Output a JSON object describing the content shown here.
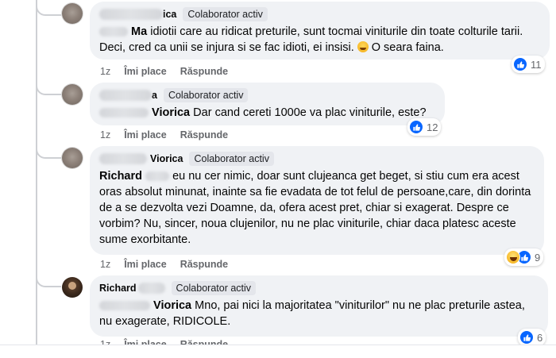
{
  "comments": [
    {
      "name_visible": "ica",
      "badge": "Colaborator activ",
      "tag": "Ma",
      "text": "idiotii care au ridicat preturile, sunt tocmai viniturile din toate colturile tarii. Deci, cred ca unii se injura si se fac idioti, ei insisi.",
      "text_after_emoji": "O seara faina.",
      "emoji": "laughing-emoji",
      "time": "1z",
      "like_label": "Îmi place",
      "reply_label": "Răspunde",
      "reaction_count": "11",
      "reaction_icons": [
        "like-icon"
      ]
    },
    {
      "name_visible": "a",
      "badge": "Colaborator activ",
      "tag": "Viorica",
      "text": "Dar cand cereti 1000e va plac viniturile, este?",
      "time": "1z",
      "like_label": "Îmi place",
      "reply_label": "Răspunde",
      "reaction_count": "12",
      "reaction_icons": [
        "like-icon"
      ]
    },
    {
      "name_visible": "Viorica",
      "badge": "Colaborator activ",
      "tag": "Richard",
      "text": "eu nu cer nimic, doar sunt clujeanca get beget, si stiu cum era acest oras absolut minunat, inainte sa fie evadata de tot felul de persoane,care, din dorinta de a se dezvolta vezi Doamne, da, ofera acest pret, chiar si exagerat. Despre ce vorbim? Nu, sincer, noua clujenilor, nu ne plac viniturile, chiar daca platesc aceste sume exorbitante.",
      "time": "1z",
      "like_label": "Îmi place",
      "reply_label": "Răspunde",
      "reaction_count": "9",
      "reaction_icons": [
        "haha-icon",
        "like-icon"
      ]
    },
    {
      "name_visible": "Richard",
      "badge": "Colaborator activ",
      "tag": "Viorica",
      "text": "Mno, pai nici la majoritatea \"viniturilor\" nu ne plac preturile astea, nu exagerate, RIDICOLE.",
      "time": "1z",
      "like_label": "Îmi place",
      "reply_label": "Răspunde",
      "reaction_count": "6",
      "reaction_icons": [
        "like-icon"
      ]
    }
  ],
  "colors": {
    "bubble": "#f0f2f5",
    "like_blue": "#0866ff",
    "muted_text": "#65676b",
    "thread_line": "#ced0d4"
  }
}
